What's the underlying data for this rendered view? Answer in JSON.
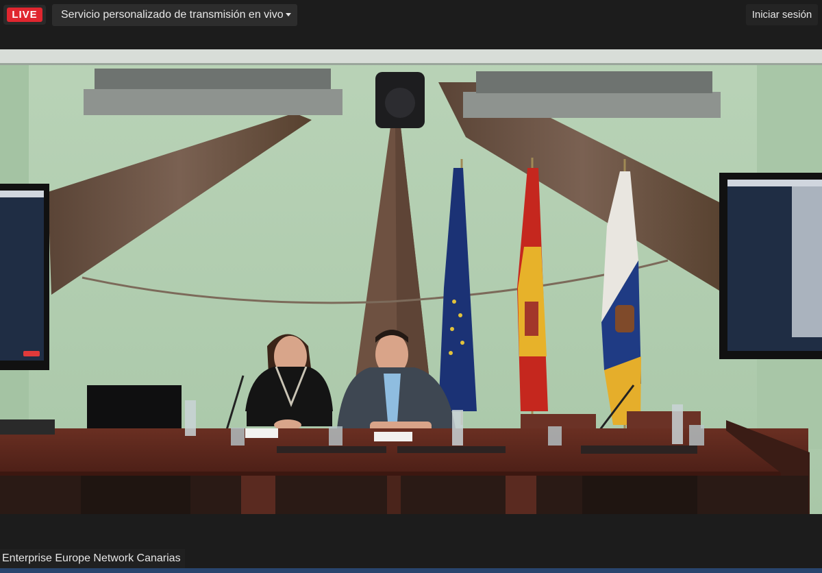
{
  "header": {
    "live_label": "LIVE",
    "stream_title": "Servicio personalizado de transmisión en vivo",
    "login_label": "Iniciar sesión"
  },
  "video": {
    "caption": "Enterprise Europe Network Canarias"
  },
  "colors": {
    "live_red": "#e0262f",
    "bar_bg": "#1c1c1c",
    "progress_blue": "#29456e"
  },
  "icons": [
    "chevron-down-icon"
  ]
}
